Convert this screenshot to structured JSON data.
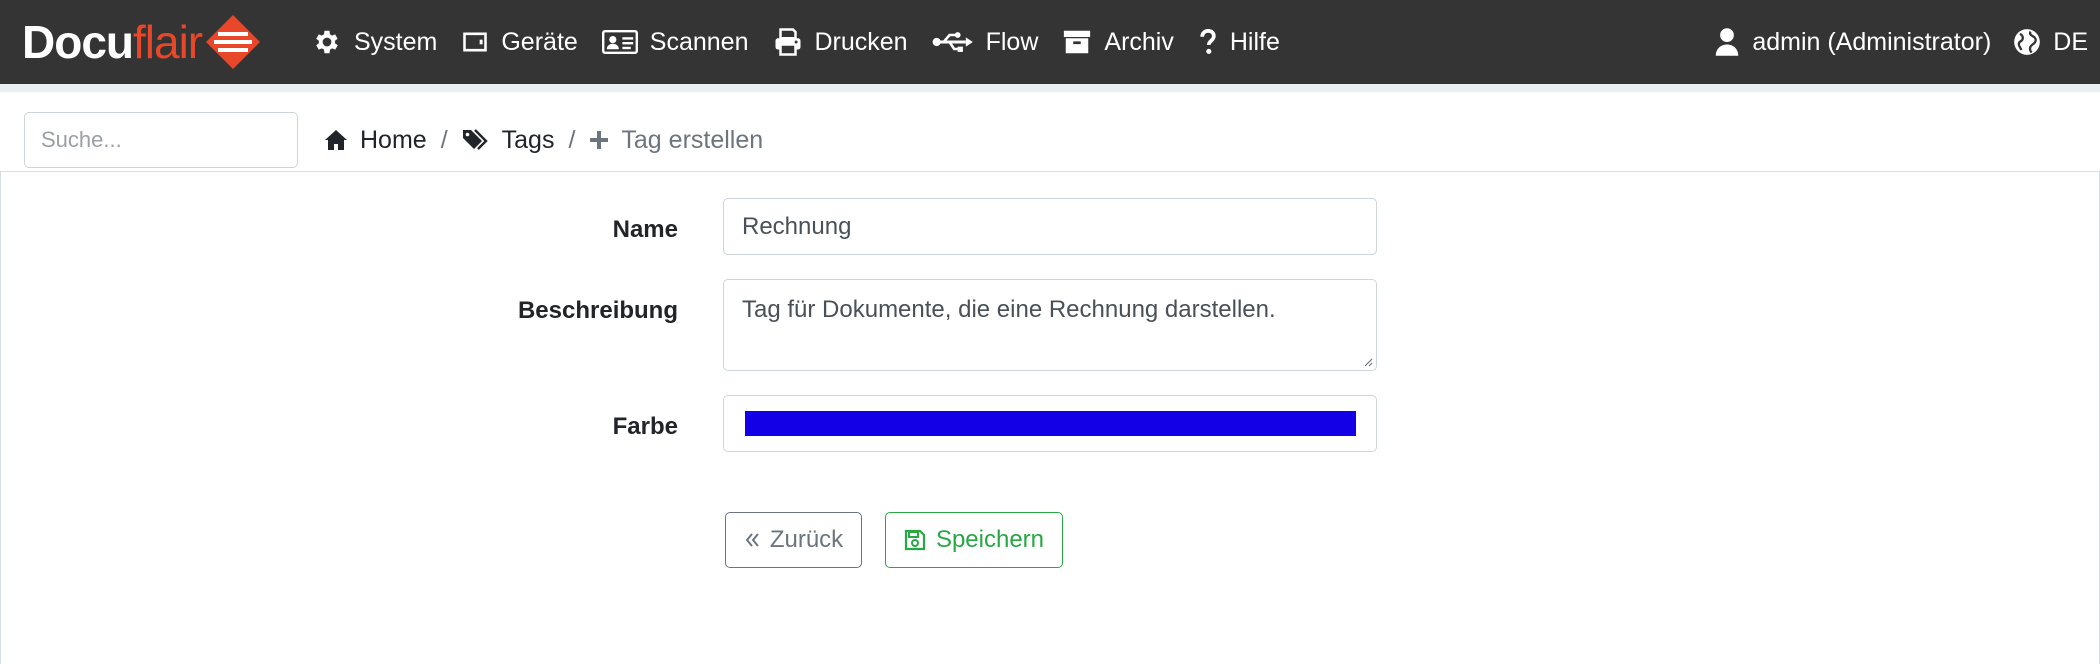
{
  "brand": {
    "part1": "Docu",
    "part2": "flair",
    "logo_icon": "docuflair-logo-icon"
  },
  "nav": {
    "items": [
      {
        "label": "System",
        "icon": "gear-icon"
      },
      {
        "label": "Geräte",
        "icon": "device-icon"
      },
      {
        "label": "Scannen",
        "icon": "id-card-icon"
      },
      {
        "label": "Drucken",
        "icon": "printer-icon"
      },
      {
        "label": "Flow",
        "icon": "usb-flow-icon"
      },
      {
        "label": "Archiv",
        "icon": "archive-box-icon"
      },
      {
        "label": "Hilfe",
        "icon": "question-icon"
      }
    ],
    "user": {
      "label": "admin (Administrator)",
      "icon": "user-icon"
    },
    "language": {
      "label": "DE",
      "icon": "globe-icon"
    }
  },
  "search": {
    "placeholder": "Suche...",
    "value": ""
  },
  "breadcrumb": {
    "home": "Home",
    "tags": "Tags",
    "current": "Tag erstellen",
    "separator": "/"
  },
  "form": {
    "name_label": "Name",
    "name_value": "Rechnung",
    "description_label": "Beschreibung",
    "description_value": "Tag für Dokumente, die eine Rechnung darstellen.",
    "color_label": "Farbe",
    "color_value": "#1400e6"
  },
  "buttons": {
    "back": "Zurück",
    "save": "Speichern"
  },
  "colors": {
    "navbar": "#343434",
    "brand_accent": "#e8472a",
    "success": "#28a745",
    "secondary": "#6c757d"
  }
}
